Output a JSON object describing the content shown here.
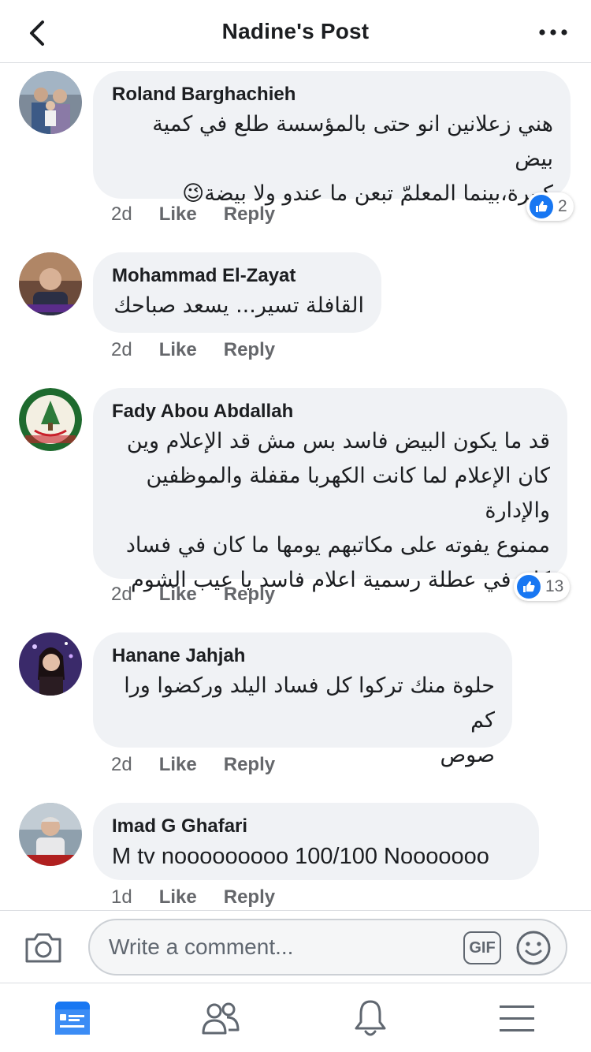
{
  "header": {
    "title": "Nadine's Post"
  },
  "comments": [
    {
      "author": "Roland Barghachieh",
      "text_lines": [
        "هني زعلانين انو حتى بالمؤسسة  طلع في كمية بيض",
        "كبيرة،بينما المعلمّ تبعن ما عندو ولا بيضة😉"
      ],
      "time": "2d",
      "like": "Like",
      "reply": "Reply",
      "reactions": "2"
    },
    {
      "author": "Mohammad El-Zayat",
      "text_lines": [
        "القافلة تسير... يسعد صباحك"
      ],
      "time": "2d",
      "like": "Like",
      "reply": "Reply",
      "reactions": ""
    },
    {
      "author": "Fady Abou Abdallah",
      "text_lines": [
        "قد ما يكون البيض فاسد بس مش قد الإعلام  وين",
        "كان الإعلام لما كانت الكهربا مقفلة والموظفين والإدارة",
        "ممنوع يفوته على مكاتبهم يومها ما كان في فساد",
        "كان في عطلة رسمية  اعلام فاسد يا عيب الشوم"
      ],
      "time": "2d",
      "like": "Like",
      "reply": "Reply",
      "reactions": "13"
    },
    {
      "author": "Hanane Jahjah",
      "text_lines": [
        "حلوة منك تركوا كل فساد اليلد وركضوا ورا كم",
        "صوص"
      ],
      "time": "2d",
      "like": "Like",
      "reply": "Reply",
      "reactions": ""
    },
    {
      "author": "Imad G Ghafari",
      "text_lines": [
        "M tv nooooooooo 100/100 Nooooooo"
      ],
      "time": "1d",
      "like": "Like",
      "reply": "Reply",
      "reactions": ""
    }
  ],
  "composer": {
    "placeholder": "Write a comment...",
    "gif_label": "GIF"
  },
  "icons": {
    "back": "chevron-left-icon",
    "more": "more-dots-icon",
    "camera": "camera-icon",
    "gif": "gif-icon",
    "emoji": "smiley-icon",
    "like_reaction": "thumbs-up-icon",
    "tab_feed": "news-feed-icon",
    "tab_friends": "friends-icon",
    "tab_notifications": "bell-icon",
    "tab_menu": "menu-icon"
  },
  "colors": {
    "accent": "#1877f2",
    "bubble": "#f0f2f5",
    "muted": "#65676b"
  }
}
